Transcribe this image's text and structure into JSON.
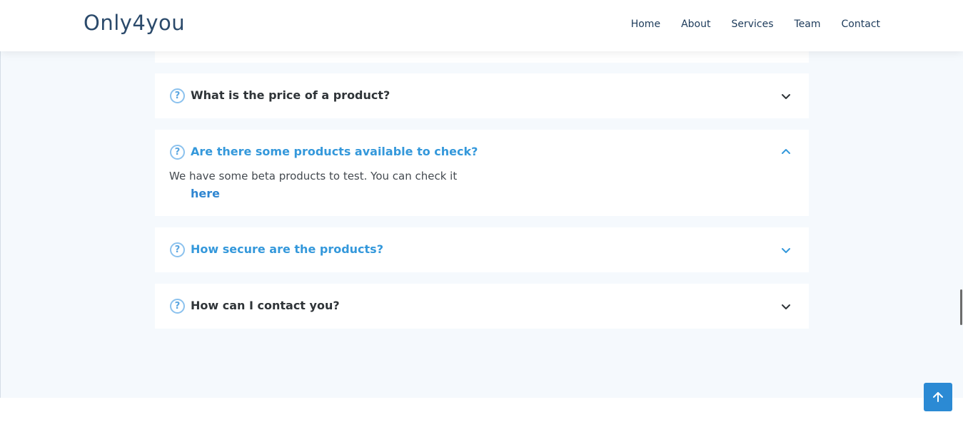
{
  "brand": {
    "name": "Only4you",
    "color": "#2b4a6b"
  },
  "nav": {
    "items": [
      "Home",
      "About",
      "Services",
      "Team",
      "Contact"
    ]
  },
  "faq": {
    "items": [
      {
        "question": "What is the price of a product?",
        "expanded": false
      },
      {
        "question": "Are there some products available to check?",
        "expanded": true,
        "answer": "We have some beta products to test. You can check it",
        "link_text": "here"
      },
      {
        "question": "How secure are the products?",
        "expanded": false
      },
      {
        "question": "How can I contact you?",
        "expanded": false
      }
    ]
  },
  "colors": {
    "accent": "#3498db",
    "icon_blue": "#8cc2ee",
    "button_bg": "#2b8ad4",
    "page_bg": "#f5f9fd"
  },
  "icons": {
    "question": "question-circle-icon",
    "chevron_down": "chevron-down-icon",
    "chevron_up": "chevron-up-icon",
    "back_to_top": "arrow-up-icon"
  }
}
